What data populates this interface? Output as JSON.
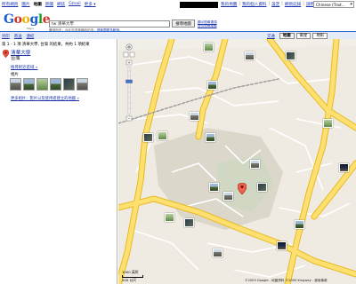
{
  "topnav": {
    "items": [
      "所有網頁",
      "圖片",
      "地圖",
      "新聞",
      "網誌",
      "Gmail",
      "更多 ▾"
    ],
    "active_index": 2,
    "user_links": [
      "我的地圖",
      "我的個人資料",
      "設定",
      "網頁記錄",
      "說明",
      "登出"
    ],
    "language": "Chinese (Trad..."
  },
  "header": {
    "logo": {
      "g1": "G",
      "o1": "o",
      "o2": "o",
      "g2": "g",
      "l": "l",
      "e": "e"
    },
    "logo_sub": "Maps",
    "search_value": "tw 清華大學",
    "search_button": "搜尋地圖",
    "side_links": [
      "顯示搜尋選項",
      "提供搜尋建議"
    ],
    "hint": "舉例而言：台北市或美國紐約市；",
    "hint_link": "請參閱更多範例。"
  },
  "toolbar": {
    "tools": [
      "列印",
      "寄送",
      "連結"
    ],
    "traffic": "交通",
    "map_buttons": [
      "地圖",
      "衛星",
      "地形"
    ],
    "selected_map": 0
  },
  "sidebar": {
    "summary": "第 1 - 1 項 清華大學, 台灣 的結果，共約 1 項結果",
    "place_name": "清華大學",
    "place_country": "台灣",
    "nearby_link": "搜尋附近區域 »",
    "photos_label": "相片",
    "more_photos": "更多相片：影片以及使用者建立的地圖 »",
    "thumb_count": 6
  },
  "map": {
    "scale_label": "1000 英呎",
    "scale_label_2": "200 公尺",
    "copyright": "©2009 Google - 地圖資料 ©2009 Kingway - 使用條款"
  },
  "colors": {
    "road_major": "#fde06f",
    "road_outline": "#e8b923",
    "map_bg": "#efebe2",
    "campus": "#dbd6ca",
    "toolbar_bg": "#e5ecf9",
    "link": "#1a33aa"
  }
}
